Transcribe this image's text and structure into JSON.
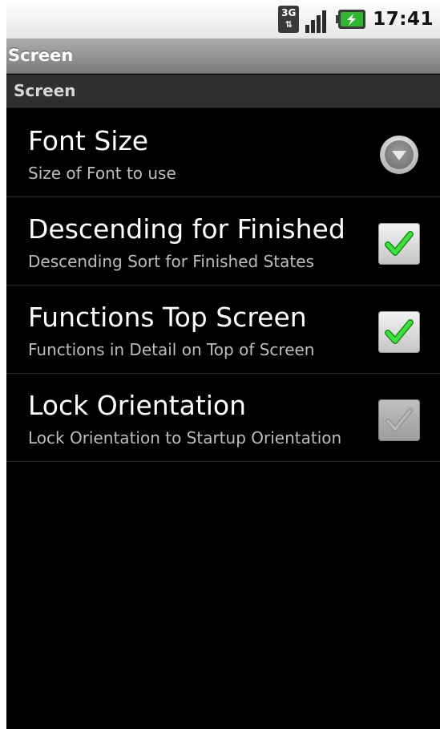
{
  "status_bar": {
    "network": "3G",
    "icons": [
      "3g-data-icon",
      "signal-strength-icon",
      "battery-charging-icon"
    ],
    "time": "17:41"
  },
  "title_bar": {
    "title": "Screen"
  },
  "category": {
    "label": "Screen"
  },
  "preferences": [
    {
      "title": "Font Size",
      "summary": "Size of Font to use",
      "widget": "dropdown"
    },
    {
      "title": "Descending for Finished",
      "summary": "Descending Sort for Finished States",
      "widget": "checkbox",
      "checked": true,
      "enabled": true
    },
    {
      "title": "Functions Top Screen",
      "summary": "Functions in Detail on Top of Screen",
      "widget": "checkbox",
      "checked": true,
      "enabled": true
    },
    {
      "title": "Lock Orientation",
      "summary": "Lock Orientation to Startup Orientation",
      "widget": "checkbox",
      "checked": true,
      "enabled": false
    }
  ],
  "colors": {
    "background": "#000000",
    "check_green": "#2ecc2e",
    "battery_green": "#2fb52f"
  }
}
